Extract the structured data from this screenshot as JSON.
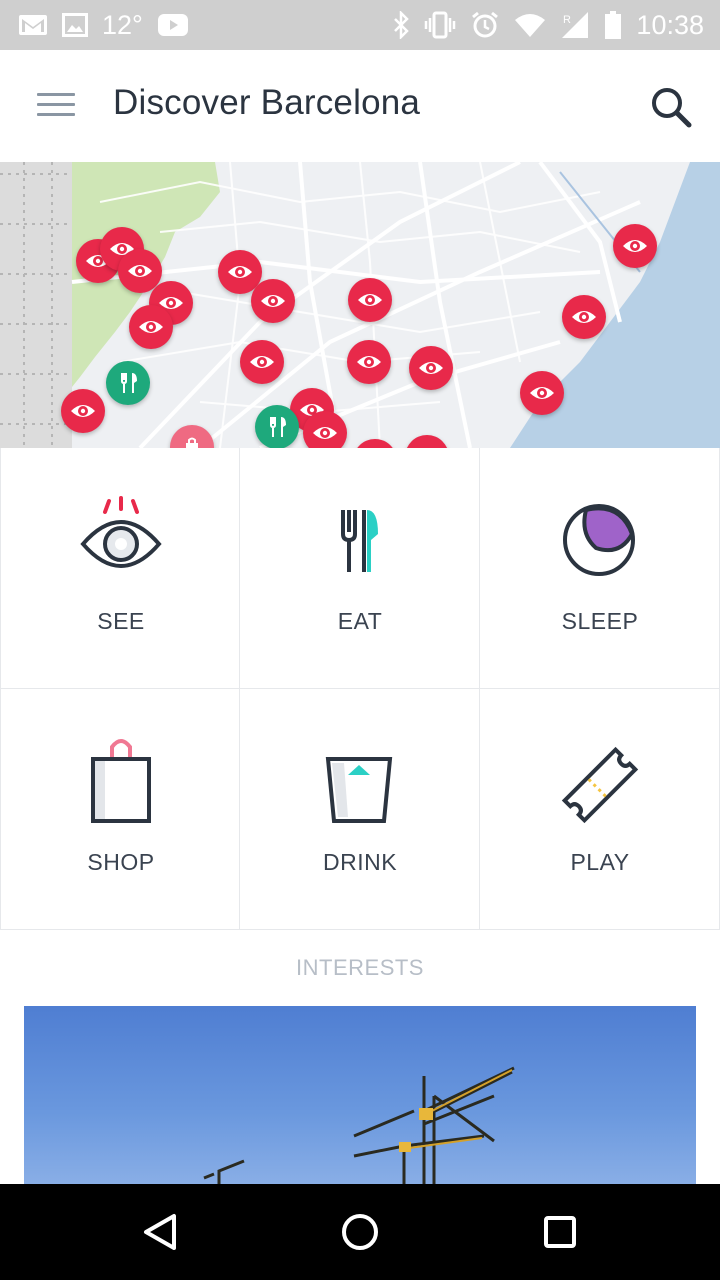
{
  "status_bar": {
    "temperature": "12°",
    "time": "10:38",
    "left_icons": [
      "gmail-icon",
      "image-icon",
      "youtube-icon"
    ],
    "right_icons": [
      "bluetooth-icon",
      "vibrate-icon",
      "alarm-icon",
      "wifi-icon",
      "signal-icon",
      "battery-icon"
    ]
  },
  "app_bar": {
    "title": "Discover Barcelona",
    "menu_icon": "hamburger-menu-icon",
    "search_icon": "search-icon"
  },
  "map": {
    "pin_types": {
      "see": "eye-icon",
      "eat": "fork-knife-icon",
      "shop": "shopping-bag-icon"
    },
    "colors": {
      "see": "#e8294a",
      "eat": "#1ea97c",
      "shop": "#ef6a82",
      "sea": "#b7d0e6",
      "park": "#cfe6b6",
      "land": "#eef0f3"
    }
  },
  "categories": [
    {
      "label": "SEE",
      "icon": "eye-icon"
    },
    {
      "label": "EAT",
      "icon": "fork-knife-icon"
    },
    {
      "label": "SLEEP",
      "icon": "moon-icon"
    },
    {
      "label": "SHOP",
      "icon": "shopping-bag-icon"
    },
    {
      "label": "DRINK",
      "icon": "glass-icon"
    },
    {
      "label": "PLAY",
      "icon": "ticket-icon"
    }
  ],
  "interests": {
    "heading": "INTERESTS"
  },
  "nav_bar": {
    "icons": [
      "back-icon",
      "home-icon",
      "recents-icon"
    ]
  },
  "colors": {
    "accent_red": "#e8294a",
    "accent_green": "#1ea97c",
    "accent_teal": "#2bd0c5",
    "accent_purple": "#9f63c9",
    "text_dark": "#2b3440"
  }
}
